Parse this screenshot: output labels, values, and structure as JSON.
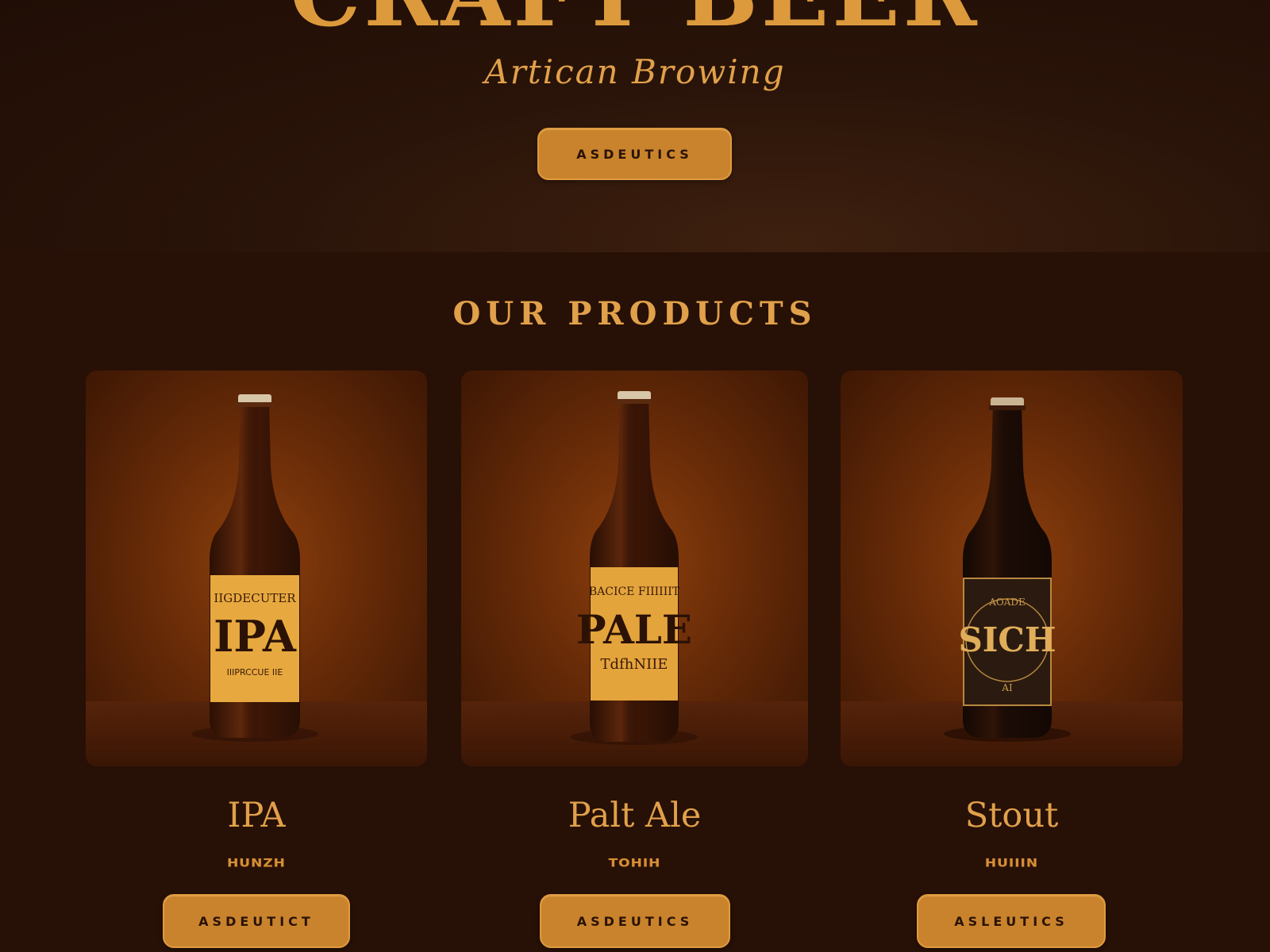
{
  "hero": {
    "title": "CRAFT BEER",
    "subtitle": "Artican Browing",
    "button_label": "ASDEUTICS"
  },
  "products_section": {
    "title": "OUR PRODUCTS"
  },
  "products": [
    {
      "name": "IPA",
      "tag": "HUNZH",
      "button_label": "ASDEUTICT",
      "label_top": "IIGDECUTER",
      "label_main": "IPA",
      "label_bottom": "IIIPRCCUE IIE",
      "glass_color": "#3d1606",
      "label_color": "#e7a93f"
    },
    {
      "name": "Palt Ale",
      "tag": "TOHIH",
      "button_label": "ASDEUTICS",
      "label_top": "BACICE FIIIIIIT",
      "label_main": "PALE",
      "label_bottom": "TdfhNIIE",
      "glass_color": "#3a1506",
      "label_color": "#e4a43c"
    },
    {
      "name": "Stout",
      "tag": "HUIIIN",
      "button_label": "ASLEUTICS",
      "label_top": "AOADE",
      "label_main": "SICH",
      "label_bottom": "AI",
      "glass_color": "#1a0b05",
      "label_color": "#2b1a0f"
    }
  ]
}
